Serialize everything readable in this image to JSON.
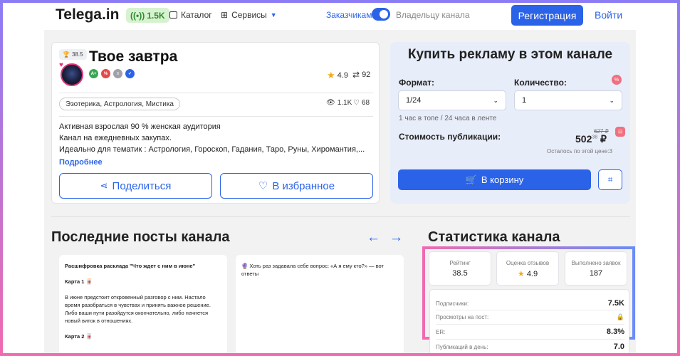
{
  "header": {
    "logo": "Telega.in",
    "online_count": "1.5K",
    "catalog": "Каталог",
    "services": "Сервисы",
    "toggle_left": "Заказчикам",
    "toggle_right": "Владельцу канала",
    "register": "Регистрация",
    "login": "Войти"
  },
  "channel": {
    "rating": "38.5",
    "title": "Твое завтра",
    "icons": [
      {
        "label": "A+",
        "color": "#3aa655"
      },
      {
        "label": "%",
        "color": "#e24a4a"
      },
      {
        "label": "≡",
        "color": "#a0a0a8"
      },
      {
        "label": "✓",
        "color": "#2b63e8"
      }
    ],
    "score": "4.9",
    "reposts": "92",
    "tag": "Эзотерика, Астрология, Мистика",
    "views": "1.1K",
    "likes": "68",
    "desc_1": "Активная взрослая 90 % женская аудитория",
    "desc_2": "Канал на ежедневных закупах.",
    "desc_3": "Идеально для тематик : Астрология, Гороскоп, Гадания, Таро, Руны, Хиромантия,...",
    "more": "Подробнее",
    "share": "Поделиться",
    "favorite": "В избранное"
  },
  "buy": {
    "title": "Купить рекламу в этом канале",
    "format_label": "Формат:",
    "format_value": "1/24",
    "quantity_label": "Количество:",
    "quantity_value": "1",
    "hint": "1 час в топе / 24 часа в ленте",
    "cost_label": "Стоимость публикации:",
    "price_old": "627 ₽",
    "price_main": "502",
    "price_cents": "38",
    "price_currency": "₽",
    "left_note": "Осталось по этой цене:3",
    "cart": "В корзину"
  },
  "posts": {
    "title": "Последние посты канала",
    "items": [
      {
        "lines": [
          "Расшифровка расклада \"Что ждет с ним в июне\"",
          "",
          "Карта 1 🀄",
          "",
          "В июне предстоит откровенный разговор с ним. Настало",
          "время разобраться в чувствах и принять важное решение.",
          "Либо ваши пути разойдутся окончательно, либо начнется",
          "новый виток в отношениях.",
          "",
          "Карта 2 🀄"
        ]
      },
      {
        "lines": [
          "🔮 Хоть раз задавала себе вопрос: «А я ему кто?» — вот",
          "ответы"
        ]
      }
    ]
  },
  "stats": {
    "title": "Статистика канала",
    "boxes": [
      {
        "label": "Рейтинг",
        "value": "38.5"
      },
      {
        "label": "Оценка отзывов",
        "value": "4.9"
      },
      {
        "label": "Выполнено заявок",
        "value": "187"
      }
    ],
    "rows": [
      {
        "label": "Подписчики:",
        "value": "7.5K"
      },
      {
        "label": "Просмотры на пост:",
        "value": "🔒"
      },
      {
        "label": "ER:",
        "value": "8.3%"
      },
      {
        "label": "Публикаций в день:",
        "value": "7.0"
      }
    ]
  }
}
